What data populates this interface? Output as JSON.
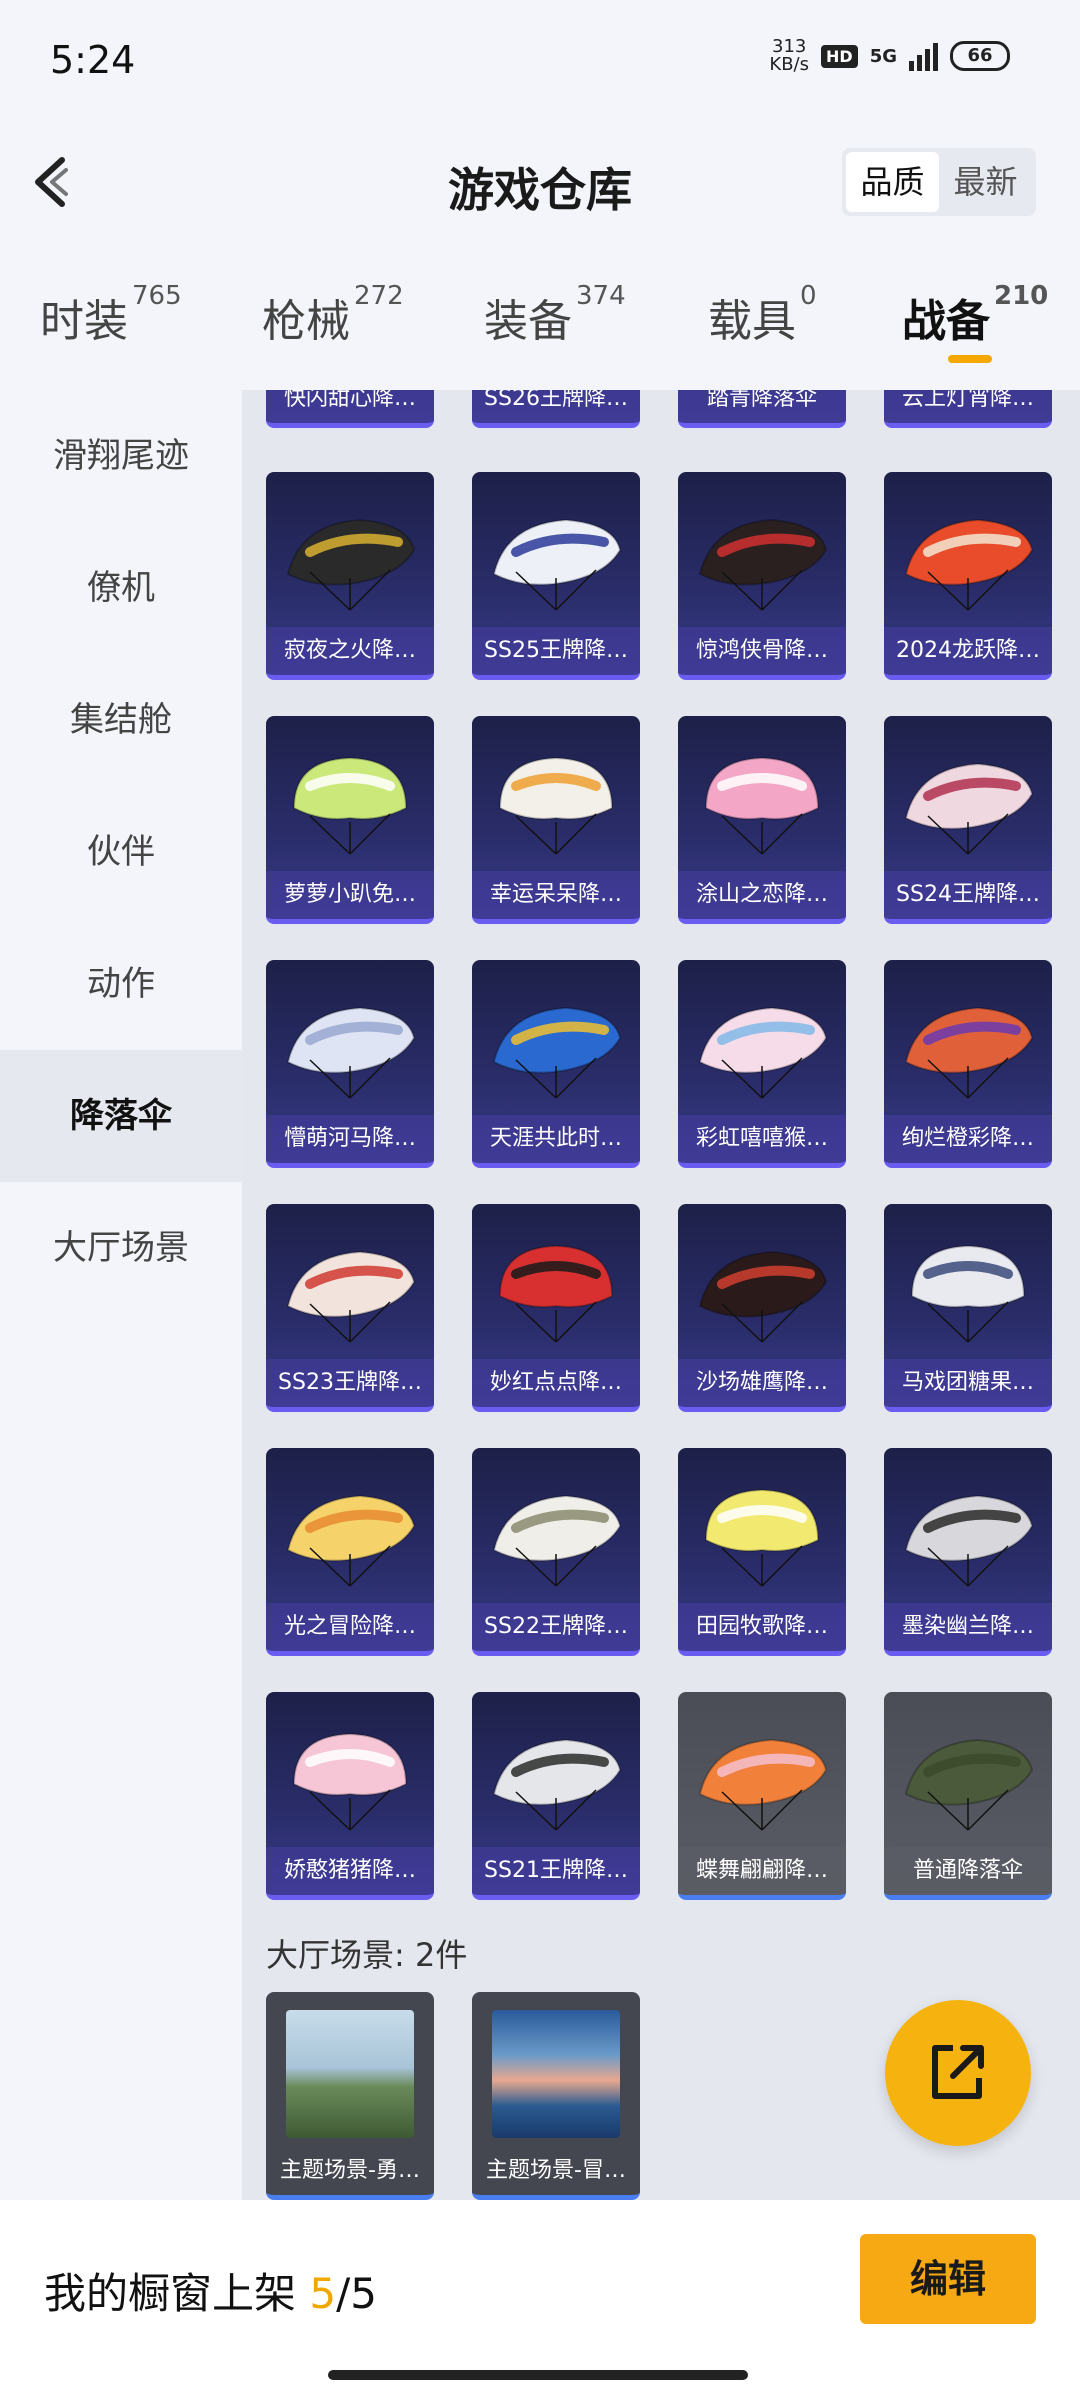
{
  "status": {
    "time": "5:24",
    "net_speed_top": "313",
    "net_speed_unit": "KB/s",
    "hd": "HD",
    "network": "5G",
    "battery": "66"
  },
  "header": {
    "title": "游戏仓库",
    "sort_options": [
      "品质",
      "最新"
    ],
    "sort_active": "品质"
  },
  "tabs": [
    {
      "label": "时装",
      "count": "765"
    },
    {
      "label": "枪械",
      "count": "272"
    },
    {
      "label": "装备",
      "count": "374"
    },
    {
      "label": "载具",
      "count": "0"
    },
    {
      "label": "战备",
      "count": "210"
    }
  ],
  "sidebar": {
    "items": [
      "滑翔尾迹",
      "僚机",
      "集结舱",
      "伙伴",
      "动作",
      "降落伞",
      "大厅场景"
    ],
    "active": "降落伞"
  },
  "partial_row": [
    "快闪甜心降…",
    "SS26王牌降…",
    "踏青降落伞",
    "云上灯宵降…"
  ],
  "parachutes": [
    {
      "name": "寂夜之火降…",
      "color": "#2a2a2a",
      "accent": "#d8b030",
      "style": "dark"
    },
    {
      "name": "SS25王牌降…",
      "color": "#eef0f8",
      "accent": "#2b3b9a",
      "style": "light"
    },
    {
      "name": "惊鸿侠骨降…",
      "color": "#2a2020",
      "accent": "#d03030",
      "style": "dark"
    },
    {
      "name": "2024龙跃降…",
      "color": "#e84c2a",
      "accent": "#f2e6d2",
      "style": "warm"
    },
    {
      "name": "萝萝小趴免…",
      "color": "#cbe87a",
      "accent": "#ffffff",
      "style": "round"
    },
    {
      "name": "幸运呆呆降…",
      "color": "#f2f0e8",
      "accent": "#f0a030",
      "style": "round"
    },
    {
      "name": "涂山之恋降…",
      "color": "#f4a6c6",
      "accent": "#ffffff",
      "style": "round"
    },
    {
      "name": "SS24王牌降…",
      "color": "#f0d8e0",
      "accent": "#b03050",
      "style": "light"
    },
    {
      "name": "懵萌河马降…",
      "color": "#dfe4f4",
      "accent": "#9aa8d0",
      "style": "light"
    },
    {
      "name": "天涯共此时…",
      "color": "#2a6ad0",
      "accent": "#f0c030",
      "style": "warm"
    },
    {
      "name": "彩虹嘻嘻猴…",
      "color": "#f6dbe8",
      "accent": "#80b8e8",
      "style": "light"
    },
    {
      "name": "绚烂橙彩降…",
      "color": "#e0603a",
      "accent": "#6a3ab0",
      "style": "warm"
    },
    {
      "name": "SS23王牌降…",
      "color": "#f2e4dc",
      "accent": "#d03a30",
      "style": "light"
    },
    {
      "name": "妙红点点降…",
      "color": "#d83030",
      "accent": "#1a1a1a",
      "style": "round"
    },
    {
      "name": "沙场雄鹰降…",
      "color": "#2a1a1a",
      "accent": "#d04030",
      "style": "dark"
    },
    {
      "name": "马戏团糖果…",
      "color": "#e8eaf0",
      "accent": "#3a4a7a",
      "style": "round"
    },
    {
      "name": "光之冒险降…",
      "color": "#f6d36a",
      "accent": "#e88a30",
      "style": "warm"
    },
    {
      "name": "SS22王牌降…",
      "color": "#f0eee8",
      "accent": "#8a8a70",
      "style": "light"
    },
    {
      "name": "田园牧歌降…",
      "color": "#f2ea70",
      "accent": "#ffffff",
      "style": "round"
    },
    {
      "name": "墨染幽兰降…",
      "color": "#d8d8dc",
      "accent": "#2a2a2a",
      "style": "light"
    },
    {
      "name": "娇憨猪猪降…",
      "color": "#f6c6d6",
      "accent": "#ffffff",
      "style": "round"
    },
    {
      "name": "SS21王牌降…",
      "color": "#e4e6ea",
      "accent": "#2a2a2a",
      "style": "light"
    },
    {
      "name": "蝶舞翩翩降…",
      "color": "#f0803a",
      "accent": "#f6c0d0",
      "style": "warm",
      "gray": true
    },
    {
      "name": "普通降落伞",
      "color": "#4a5a3a",
      "accent": "#3a4a2a",
      "style": "dark",
      "gray": true
    }
  ],
  "scenes": {
    "title": "大厅场景: 2件",
    "items": [
      {
        "name": "主题场景-勇…",
        "sky": "#bcd6e8",
        "ground": "#5a7a4a"
      },
      {
        "name": "主题场景-冒…",
        "sky": "#3a70b0",
        "ground": "#e8b090"
      }
    ]
  },
  "bottom": {
    "label": "我的橱窗上架",
    "current": "5",
    "separator": "/",
    "total": "5",
    "edit": "编辑"
  }
}
